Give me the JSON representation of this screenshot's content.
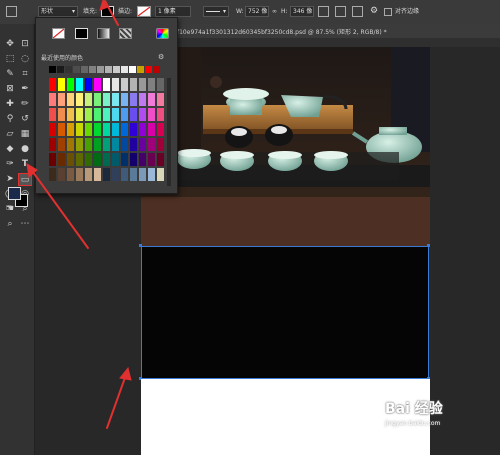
{
  "options_bar": {
    "shape_mode": "形状",
    "fill_label": "填充:",
    "stroke_label": "描边:",
    "stroke_width": "1 像素",
    "w_label": "W:",
    "w_value": "752 像",
    "h_label": "H:",
    "h_value": "346 像",
    "align_edges_label": "对齐边缘"
  },
  "document_tab": {
    "title": "f10e974a1f3301312d60345bf3250cd8.psd @ 87.5% (矩形 2, RGB/8) *"
  },
  "swatch_panel": {
    "recent_label": "最近使用的颜色",
    "recent_colors": [
      "#000000",
      "#1a1a1a",
      "#333333",
      "#4d4d4d",
      "#666666",
      "#808080",
      "#999999",
      "#b3b3b3",
      "#cccccc",
      "#e6e6e6",
      "#ffffff",
      "#c8a000",
      "#ff0000",
      "#c00000"
    ],
    "grid_colors": [
      [
        "#ff0000",
        "#ffff00",
        "#00ff00",
        "#00ffff",
        "#0000ff",
        "#ff00ff",
        "#ffffff",
        "#e6e6e6",
        "#cccccc",
        "#b3b3b3",
        "#999999",
        "#808080",
        "#666666"
      ],
      [
        "#ff7a7a",
        "#ffa07a",
        "#ffd27a",
        "#fff17a",
        "#c8f07a",
        "#7af07a",
        "#7af0c8",
        "#7ae6f0",
        "#7ab4f0",
        "#8a7af0",
        "#c07af0",
        "#f07ad8",
        "#f07aa0"
      ],
      [
        "#f04d4d",
        "#f08c4d",
        "#f0c04d",
        "#e6f04d",
        "#a0f04d",
        "#4df070",
        "#4df0c0",
        "#4dd8f0",
        "#4d9cf0",
        "#6a4df0",
        "#b04df0",
        "#f04dc8",
        "#f04d80"
      ],
      [
        "#d80000",
        "#d85a00",
        "#d8a000",
        "#c8d800",
        "#6ad800",
        "#00d830",
        "#00d8a0",
        "#00b8d8",
        "#0068d8",
        "#3000d8",
        "#9000d8",
        "#d800a8",
        "#d80050"
      ],
      [
        "#a00000",
        "#a04000",
        "#a07800",
        "#90a000",
        "#4aa000",
        "#00a020",
        "#00a078",
        "#0088a0",
        "#0048a0",
        "#2000a0",
        "#6a00a0",
        "#a0007a",
        "#a0003a"
      ],
      [
        "#6a0000",
        "#6a2a00",
        "#6a5000",
        "#5e6a00",
        "#306a00",
        "#006a14",
        "#006a50",
        "#005a6a",
        "#00306a",
        "#14006a",
        "#46006a",
        "#6a0050",
        "#6a0026"
      ],
      [
        "#3c2a1a",
        "#5a4030",
        "#7a5a40",
        "#9a7a5a",
        "#b89a7a",
        "#d8b89a",
        "#1a2a3c",
        "#30405a",
        "#405a7a",
        "#5a7a9a",
        "#7a9ab8",
        "#9ab8d8",
        "#d8d8b8"
      ]
    ]
  },
  "toolbar": {
    "icons": [
      "move-icon",
      "artboard-icon",
      "marquee-icon",
      "lasso-icon",
      "quick-select-icon",
      "crop-icon",
      "eyedropper-icon",
      "frame-icon",
      "healing-brush-icon",
      "brush-icon",
      "clone-stamp-icon",
      "history-brush-icon",
      "eraser-icon",
      "gradient-icon",
      "blur-icon",
      "dodge-icon",
      "pen-icon",
      "type-icon",
      "path-select-icon",
      "rectangle-icon",
      "ellipse-icon",
      "custom-shape-icon",
      "hand-icon",
      "zoom-icon",
      "more-icon"
    ]
  },
  "colors": {
    "foreground": "#1b2a4a",
    "background": "#000000",
    "annotation_arrow": "#e03030",
    "selection": "#3a7bd5"
  },
  "watermark": {
    "brand_text": "Bai 经验",
    "url": "jingyan.baidu.com"
  }
}
